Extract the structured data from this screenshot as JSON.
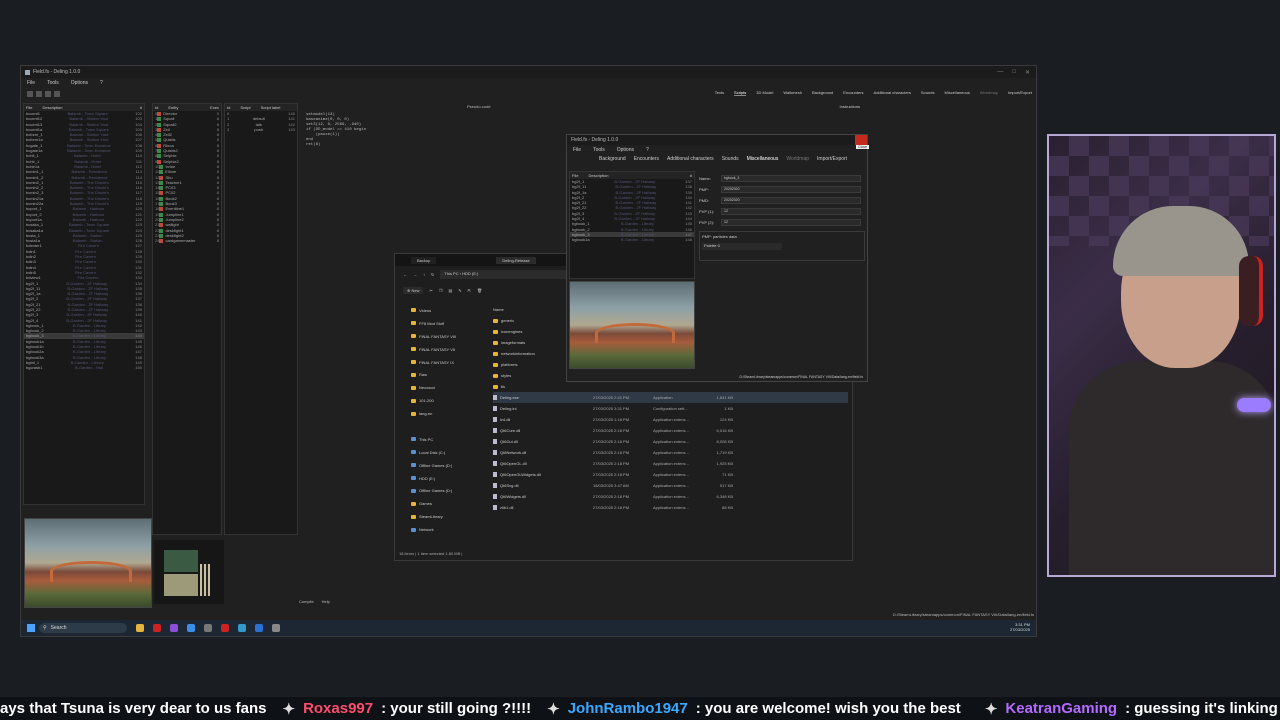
{
  "deling_main": {
    "title": "Field.fs - Deling 1.0.0",
    "menu": [
      "File",
      "Tools",
      "Options",
      "?"
    ],
    "nav_tabs": [
      "Texts",
      "Scripts",
      "3D Model",
      "Walkmesh",
      "Background",
      "Encounters",
      "Additional characters",
      "Sounds",
      "Miscellaneous",
      "Worldmap",
      "Import/Export"
    ],
    "instructions_label": "Instructions",
    "field_list_header": {
      "file": "File",
      "description": "Description",
      "id": "#"
    },
    "field_list": [
      [
        "bccent1",
        "Balamb - Town Square",
        "102"
      ],
      [
        "bccent12",
        "Balamb - Station Yard",
        "103"
      ],
      [
        "bccent13",
        "Balamb - Station Yard",
        "104"
      ],
      [
        "bccent1a",
        "Balamb - Town Square",
        "105"
      ],
      [
        "bcform_1",
        "Balamb - Station Yard",
        "106"
      ],
      [
        "bcform1a",
        "Balamb - Station Yard",
        "107"
      ],
      [
        "bcgate_1",
        "Balamb - Town Entrance",
        "108"
      ],
      [
        "bcgate1a",
        "Balamb - Town Entrance",
        "109"
      ],
      [
        "bchtl_1",
        "Balamb - Hotel",
        "110"
      ],
      [
        "bchtr_1",
        "Balamb - Hotel",
        "111"
      ],
      [
        "bchtr1a",
        "Balamb - Hotel",
        "112"
      ],
      [
        "bcmin1_1",
        "Balamb - Residence",
        "113"
      ],
      [
        "bcmin1_2",
        "Balamb - Residence",
        "114"
      ],
      [
        "bcmin2_1",
        "Balamb - The Dincht's",
        "115"
      ],
      [
        "bcmin2_2",
        "Balamb - The Dincht's",
        "116"
      ],
      [
        "bcmin2_3",
        "Balamb - The Dincht's",
        "117"
      ],
      [
        "bcmin21a",
        "Balamb - The Dincht's",
        "118"
      ],
      [
        "bcmin22a",
        "Balamb - The Dincht's",
        "119"
      ],
      [
        "bcport_1",
        "Balamb - Harbour",
        "120"
      ],
      [
        "bcport_2",
        "Balamb - Harbour",
        "121"
      ],
      [
        "bcport1a",
        "Balamb - Harbour",
        "122"
      ],
      [
        "bcsaka_1",
        "Balamb - Town Square",
        "123"
      ],
      [
        "bcsaka1a",
        "Balamb - Town Square",
        "124"
      ],
      [
        "bcsta_1",
        "Balamb - Station",
        "125"
      ],
      [
        "bcsta1a",
        "Balamb - Station",
        "126"
      ],
      [
        "bdenter1",
        "Fire Cavern",
        "127"
      ],
      [
        "bdin1",
        "Fire Cavern",
        "128"
      ],
      [
        "bdin2",
        "Fire Cavern",
        "129"
      ],
      [
        "bdin3",
        "Fire Cavern",
        "130"
      ],
      [
        "bdin4",
        "Fire Cavern",
        "131"
      ],
      [
        "bdin5",
        "Fire Cavern",
        "132"
      ],
      [
        "bdview1",
        "Fire Cavern",
        "133"
      ],
      [
        "bg2f_1",
        "B-Garden - 2F Hallway",
        "134"
      ],
      [
        "bg2f_11",
        "B-Garden - 2F Hallway",
        "135"
      ],
      [
        "bg2f_1a",
        "B-Garden - 2F Hallway",
        "136"
      ],
      [
        "bg2f_2",
        "B-Garden - 2F Hallway",
        "137"
      ],
      [
        "bg2f_21",
        "B-Garden - 2F Hallway",
        "138"
      ],
      [
        "bg2f_22",
        "B-Garden - 2F Hallway",
        "139"
      ],
      [
        "bg2f_3",
        "B-Garden - 2F Hallway",
        "140"
      ],
      [
        "bg2f_4",
        "B-Garden - 2F Hallway",
        "141"
      ],
      [
        "bgbook_1",
        "B-Garden - Library",
        "142"
      ],
      [
        "bgbook_2",
        "B-Garden - Library",
        "143"
      ],
      [
        "bgbook_3",
        "B-Garden - Library",
        "144"
      ],
      [
        "bgbook1a",
        "B-Garden - Library",
        "145"
      ],
      [
        "bgbook1b",
        "B-Garden - Library",
        "146"
      ],
      [
        "bgbook2a",
        "B-Garden - Library",
        "147"
      ],
      [
        "bgbook3a",
        "B-Garden - Library",
        "148"
      ],
      [
        "bgbtl_1",
        "B-Garden - Library",
        "149"
      ],
      [
        "bgcrash1",
        "B-Garden - Hall",
        "150"
      ]
    ],
    "selected_field": "bgbook_3",
    "entity_header": {
      "id": "Id",
      "entity": "Entity",
      "exec": "Exec"
    },
    "entities": [
      [
        "0",
        "Director",
        "0"
      ],
      [
        "1",
        "Squall",
        "8"
      ],
      [
        "2",
        "Squall2",
        "8"
      ],
      [
        "3",
        "Zell",
        "8"
      ],
      [
        "4",
        "Zell2",
        "8"
      ],
      [
        "5",
        "Quistis",
        "8"
      ],
      [
        "6",
        "Rinoa",
        "8"
      ],
      [
        "7",
        "Quistis2",
        "8"
      ],
      [
        "8",
        "Selphie",
        "8"
      ],
      [
        "9",
        "Selphie2",
        "8"
      ],
      [
        "10",
        "Irvine",
        "8"
      ],
      [
        "11",
        "Ellone",
        "8"
      ],
      [
        "12",
        "Shu",
        "8"
      ],
      [
        "13",
        "Teacher1",
        "8"
      ],
      [
        "14",
        "PC03",
        "8"
      ],
      [
        "15",
        "PC02",
        "8"
      ],
      [
        "16",
        "Book2",
        "8"
      ],
      [
        "17",
        "Book3",
        "8"
      ],
      [
        "18",
        "Eventline1",
        "8"
      ],
      [
        "19",
        "Jumpline1",
        "8"
      ],
      [
        "20",
        "Jumpline2",
        "8"
      ],
      [
        "21",
        "wallight",
        "8"
      ],
      [
        "22",
        "deskfight1",
        "8"
      ],
      [
        "23",
        "deskfight2",
        "8"
      ],
      [
        "24",
        "cardgamemaster",
        "8"
      ]
    ],
    "script_header": {
      "id": "Id",
      "script": "Script",
      "label": "Script label"
    },
    "scripts": [
      [
        "0",
        "",
        "140"
      ],
      [
        "1",
        "default",
        "141"
      ],
      [
        "2",
        "talk",
        "142"
      ],
      [
        "3",
        "push",
        "143"
      ]
    ],
    "pseudo_code_label": "Pseudo-code",
    "code_lines": [
      "setmodel(13)",
      "baseanime(0, 0, 0)",
      "set3(12, 0, 2569, -940)",
      "if (DD_model == 410 begin",
      "    (pause(1))",
      "end",
      "ret(8)"
    ],
    "bottom_tabs": [
      "Compile",
      "Help"
    ],
    "status_path": "D:/SteamLibrary/steamapps/common/FINAL FANTASY VIII/Data/lang-en/field.fs"
  },
  "deling_small": {
    "title": "Field.fs - Deling 1.0.0",
    "menu": [
      "File",
      "Tools",
      "Options",
      "?"
    ],
    "tabs": [
      "Background",
      "Encounters",
      "Additional characters",
      "Sounds",
      "Miscellaneous",
      "Worldmap",
      "Import/Export"
    ],
    "list_header": {
      "file": "File",
      "description": "Description",
      "id": "#"
    },
    "list": [
      [
        "bg2f_1",
        "B-Garden - 2F Hallway",
        "137"
      ],
      [
        "bg2f_11",
        "B-Garden - 2F Hallway",
        "138"
      ],
      [
        "bg2f_1a",
        "B-Garden - 2F Hallway",
        "139"
      ],
      [
        "bg2f_2",
        "B-Garden - 2F Hallway",
        "140"
      ],
      [
        "bg2f_21",
        "B-Garden - 2F Hallway",
        "141"
      ],
      [
        "bg2f_22",
        "B-Garden - 2F Hallway",
        "142"
      ],
      [
        "bg2f_3",
        "B-Garden - 2F Hallway",
        "143"
      ],
      [
        "bg2f_4",
        "B-Garden - 2F Hallway",
        "144"
      ],
      [
        "bgbook_1",
        "B-Garden - Library",
        "145"
      ],
      [
        "bgbook_2",
        "B-Garden - Library",
        "146"
      ],
      [
        "bgbook_3",
        "B-Garden - Library",
        "147"
      ],
      [
        "bgbook1a",
        "B-Garden - Library",
        "148"
      ]
    ],
    "fields": [
      {
        "label": "Name:",
        "value": "bgbook_3"
      },
      {
        "label": "PMP:",
        "value": "20202020"
      },
      {
        "label": "PMD:",
        "value": "20202020"
      },
      {
        "label": "PVP (1):",
        "value": "12"
      },
      {
        "label": "PVP (2):",
        "value": "12"
      }
    ],
    "pmp_group_label": "PMP: particles data",
    "palette_label": "Palette 0",
    "close_tooltip": "Close",
    "path": "D:/SteamLibrary/steamapps/common/FINAL FANTASY VIII/Data/lang-en/field.fs"
  },
  "explorer": {
    "tabs": [
      "Backup",
      "Deling-Release"
    ],
    "breadcrumb": [
      "This PC",
      "HDD (E:)"
    ],
    "new_label": "New",
    "name_header": "Name",
    "nav_items": [
      "Videos",
      "FF8 Mod Stuff",
      "FINAL FANTASY VIII",
      "FINAL FANTASY VII",
      "FINAL FANTASY IX",
      "Raw",
      "Necoscci",
      "101-200",
      "lang-en",
      "",
      "This PC",
      "Local Disk (C:)",
      "Offline Games (D:)",
      "HDD (E:)",
      "Offline Games (D:)",
      "Games",
      "SteamLibrary",
      "Network"
    ],
    "folders": [
      "generic",
      "iconengines",
      "imageformats",
      "networkinformation",
      "platforms",
      "styles",
      "tls"
    ],
    "files": [
      {
        "name": "Deling.exe",
        "date": "27/03/2025 2:41 PM",
        "type": "Application",
        "size": "1,641 KB"
      },
      {
        "name": "Deling.ini",
        "date": "27/03/2025 3:31 PM",
        "type": "Configuration sett...",
        "size": "1 KB"
      },
      {
        "name": "lz4.dll",
        "date": "27/03/2025 1:18 PM",
        "type": "Application extens...",
        "size": "124 KB"
      },
      {
        "name": "Qt6Core.dll",
        "date": "27/03/2025 2:18 PM",
        "type": "Application extens...",
        "size": "6,016 KB"
      },
      {
        "name": "Qt6Gui.dll",
        "date": "27/03/2025 2:18 PM",
        "type": "Application extens...",
        "size": "8,008 KB"
      },
      {
        "name": "Qt6Network.dll",
        "date": "27/03/2025 2:18 PM",
        "type": "Application extens...",
        "size": "1,719 KB"
      },
      {
        "name": "Qt6OpenGL.dll",
        "date": "27/03/2025 2:18 PM",
        "type": "Application extens...",
        "size": "1,925 KB"
      },
      {
        "name": "Qt6OpenGLWidgets.dll",
        "date": "27/03/2025 2:18 PM",
        "type": "Application extens...",
        "size": "71 KB"
      },
      {
        "name": "Qt6Svg.dll",
        "date": "18/03/2025 3:47 AM",
        "type": "Application extens...",
        "size": "517 KB"
      },
      {
        "name": "Qt6Widgets.dll",
        "date": "27/03/2025 2:18 PM",
        "type": "Application extens...",
        "size": "6,348 KB"
      },
      {
        "name": "zlib1.dll",
        "date": "27/03/2025 2:18 PM",
        "type": "Application extens...",
        "size": "88 KB"
      }
    ],
    "status": "18 items  |  1 item selected  1.60 MB  |"
  },
  "taskbar": {
    "search_placeholder": "Search",
    "time": "3:31 PM",
    "date": "27/03/2025"
  },
  "ticker": [
    {
      "user": "",
      "text": "ays that Tsuna is very dear to us fans",
      "color": "#ffffff"
    },
    {
      "user": "Roxas997",
      "text": ": your still going ?!!!!",
      "color": "#ff4d6d"
    },
    {
      "user": "JohnRambo1947",
      "text": ": you are welcome! wish you the best",
      "color": "#3aa8ff"
    },
    {
      "user": "KeatranGaming",
      "text": ": guessing it's linking to files...",
      "color": "#b36bff"
    }
  ]
}
